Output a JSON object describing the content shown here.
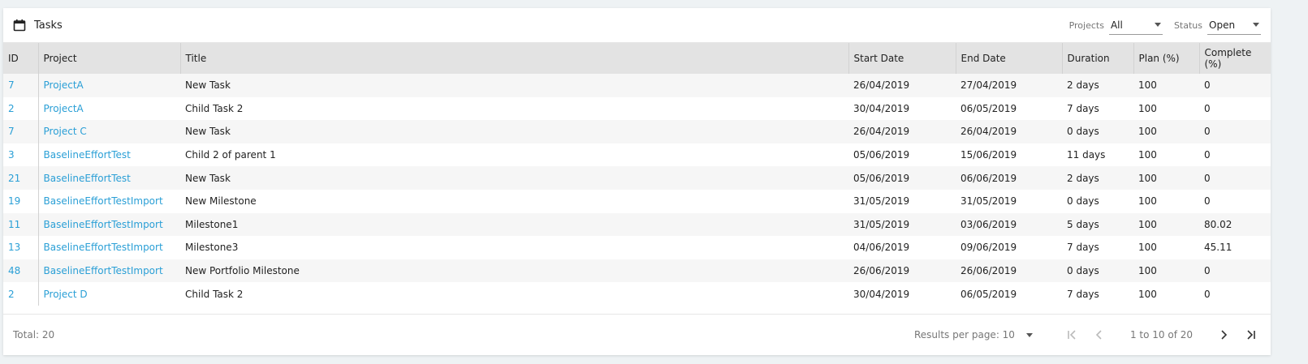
{
  "header": {
    "title": "Tasks",
    "projects_label": "Projects",
    "projects_value": "All",
    "status_label": "Status",
    "status_value": "Open"
  },
  "table": {
    "columns": [
      "ID",
      "Project",
      "Title",
      "Start Date",
      "End Date",
      "Duration",
      "Plan (%)",
      "Complete (%)"
    ],
    "rows": [
      [
        "7",
        "ProjectA",
        "New Task",
        "26/04/2019",
        "27/04/2019",
        "2 days",
        "100",
        "0"
      ],
      [
        "2",
        "ProjectA",
        "Child Task 2",
        "30/04/2019",
        "06/05/2019",
        "7 days",
        "100",
        "0"
      ],
      [
        "7",
        "Project C",
        "New Task",
        "26/04/2019",
        "26/04/2019",
        "0 days",
        "100",
        "0"
      ],
      [
        "3",
        "BaselineEffortTest",
        "Child 2 of parent 1",
        "05/06/2019",
        "15/06/2019",
        "11 days",
        "100",
        "0"
      ],
      [
        "21",
        "BaselineEffortTest",
        "New Task",
        "05/06/2019",
        "06/06/2019",
        "2 days",
        "100",
        "0"
      ],
      [
        "19",
        "BaselineEffortTestImport",
        "New Milestone",
        "31/05/2019",
        "31/05/2019",
        "0 days",
        "100",
        "0"
      ],
      [
        "11",
        "BaselineEffortTestImport",
        "Milestone1",
        "31/05/2019",
        "03/06/2019",
        "5 days",
        "100",
        "80.02"
      ],
      [
        "13",
        "BaselineEffortTestImport",
        "Milestone3",
        "04/06/2019",
        "09/06/2019",
        "7 days",
        "100",
        "45.11"
      ],
      [
        "48",
        "BaselineEffortTestImport",
        "New Portfolio Milestone",
        "26/06/2019",
        "26/06/2019",
        "0 days",
        "100",
        "0"
      ],
      [
        "2",
        "Project D",
        "Child Task 2",
        "30/04/2019",
        "06/05/2019",
        "7 days",
        "100",
        "0"
      ]
    ]
  },
  "footer": {
    "total": "Total: 20",
    "results_per_page": "Results per page: 10",
    "range": "1 to 10 of 20"
  },
  "colors": {
    "link": "#2a9fd6",
    "header_bg": "#e3e3e3",
    "row_alt": "#f6f6f6"
  },
  "icons": [
    "calendar-icon",
    "chevron-down-icon",
    "first-page-icon",
    "prev-page-icon",
    "next-page-icon",
    "last-page-icon"
  ]
}
